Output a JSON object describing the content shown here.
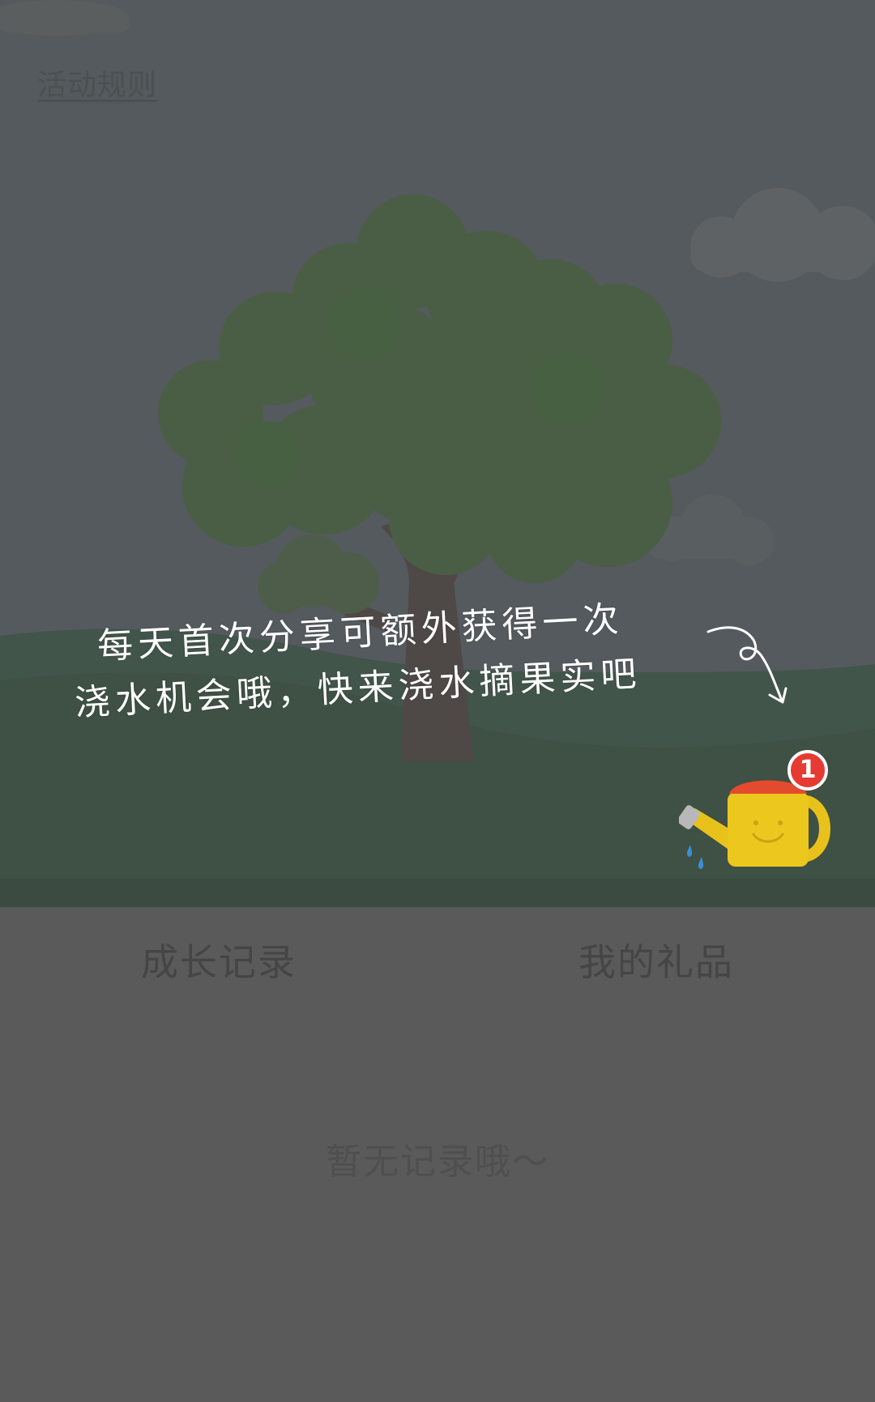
{
  "header": {
    "rules_link": "活动规则"
  },
  "hint": {
    "line1": "每天首次分享可额外获得一次",
    "line2": "浇水机会哦，快来浇水摘果实吧"
  },
  "watering_can": {
    "badge_count": "1"
  },
  "tabs": [
    {
      "label": "成长记录"
    },
    {
      "label": "我的礼品"
    }
  ],
  "empty_state": {
    "text": "暂无记录哦～"
  },
  "colors": {
    "overlay_sky": "#545a5d",
    "tree_foliage": "#4a5e45",
    "ground": "#435449",
    "panel": "#5a5a5a",
    "badge": "#e53b33",
    "can": "#e8c21b"
  }
}
